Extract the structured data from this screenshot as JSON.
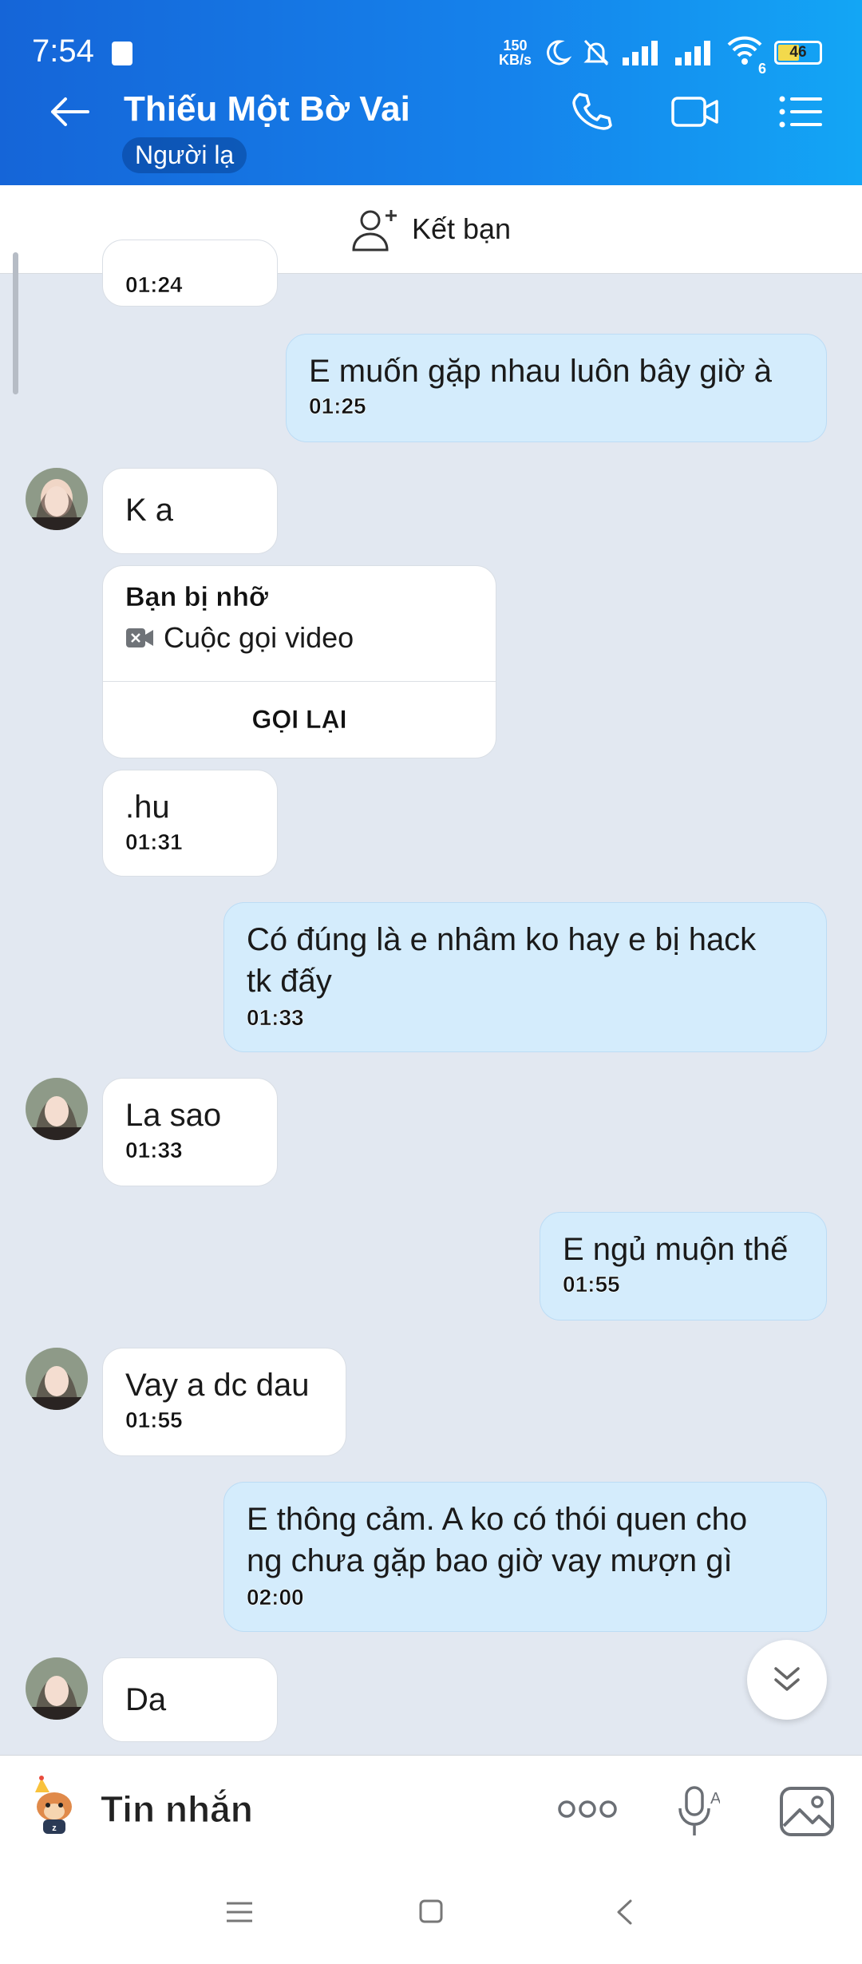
{
  "status": {
    "time": "7:54",
    "net_speed_top": "150",
    "net_speed_bottom": "KB/s",
    "wifi_num": "6",
    "battery": "46"
  },
  "header": {
    "contact_name": "Thiếu Một Bờ Vai",
    "contact_badge": "Người lạ"
  },
  "add_friend": {
    "label": "Kết bạn"
  },
  "messages": {
    "m0_time": "01:24",
    "m1_text": "E muốn gặp nhau luôn bây giờ à",
    "m1_time": "01:25",
    "m2_text": "K a",
    "missed_title": "Bạn bị nhỡ",
    "missed_sub": "Cuộc gọi video",
    "callback": "GỌI LẠI",
    "m3_text": ".hu",
    "m3_time": "01:31",
    "m4_text_1": "Có đúng là e nhâm ko hay e bị hack",
    "m4_text_2": "tk đấy",
    "m4_time": "01:33",
    "m5_text": "La sao",
    "m5_time": "01:33",
    "m6_text": "E ngủ muộn thế",
    "m6_time": "01:55",
    "m7_text": "Vay a dc dau",
    "m7_time": "01:55",
    "m8_text_1": "E thông cảm. A ko có thói quen cho",
    "m8_text_2": "ng chưa gặp bao giờ vay mượn gì",
    "m8_time": "02:00",
    "m9_text": "Da"
  },
  "input": {
    "placeholder": "Tin nhắn"
  },
  "colors": {
    "header_start": "#1565d8",
    "header_end": "#13a6f5",
    "outgoing_bubble": "#d4ecfc",
    "incoming_bubble": "#ffffff",
    "chat_bg": "#e2e8f1"
  }
}
